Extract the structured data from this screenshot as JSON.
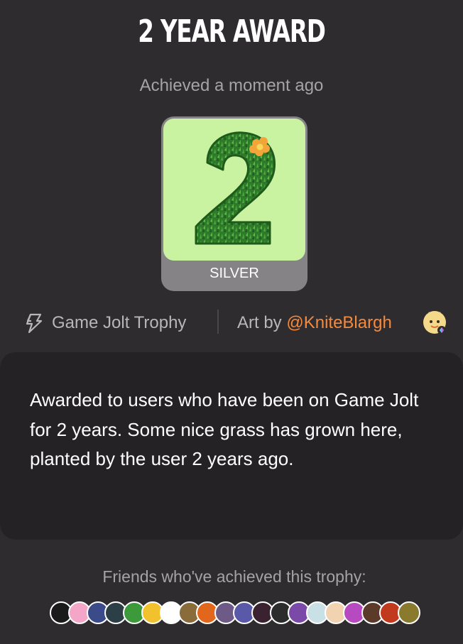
{
  "trophy": {
    "title": "2 YEAR AWARD",
    "achieved": "Achieved a moment ago",
    "tier": "SILVER",
    "art_icon": "grass-number-two-icon"
  },
  "meta": {
    "source_icon": "bolt-icon",
    "source": "Game Jolt Trophy",
    "art_by_prefix": "Art by ",
    "artist": "@KniteBlargh"
  },
  "description": "Awarded to users who have been on Game Jolt for 2 years. Some nice grass has grown here, planted by the user 2 years ago.",
  "friends": {
    "label": "Friends who've achieved this trophy:",
    "avatars": [
      {
        "name": "friend-avatar",
        "color": "#1a1a1a"
      },
      {
        "name": "friend-avatar",
        "color": "#f3a6c8"
      },
      {
        "name": "friend-avatar",
        "color": "#3b4b8a"
      },
      {
        "name": "friend-avatar",
        "color": "#2c3e46"
      },
      {
        "name": "friend-avatar",
        "color": "#3d9a3a"
      },
      {
        "name": "friend-avatar",
        "color": "#f2c12e"
      },
      {
        "name": "friend-avatar",
        "color": "#ffffff"
      },
      {
        "name": "friend-avatar",
        "color": "#8a6b3a"
      },
      {
        "name": "friend-avatar",
        "color": "#e2661c"
      },
      {
        "name": "friend-avatar",
        "color": "#6d5a86"
      },
      {
        "name": "friend-avatar",
        "color": "#5a58a8"
      },
      {
        "name": "friend-avatar",
        "color": "#3a2230"
      },
      {
        "name": "friend-avatar",
        "color": "#2c2c2c"
      },
      {
        "name": "friend-avatar",
        "color": "#7b4aa8"
      },
      {
        "name": "friend-avatar",
        "color": "#c8e0e6"
      },
      {
        "name": "friend-avatar",
        "color": "#f1d3b1"
      },
      {
        "name": "friend-avatar",
        "color": "#b74ac0"
      },
      {
        "name": "friend-avatar",
        "color": "#5b3a2a"
      },
      {
        "name": "friend-avatar",
        "color": "#c23a1e"
      },
      {
        "name": "friend-avatar",
        "color": "#8a7a2e"
      }
    ]
  },
  "colors": {
    "background": "#2f2c2f",
    "panel": "#242224",
    "accent": "#f48a3d",
    "muted_text": "#a6a2a6",
    "art_background": "#c9f2a1",
    "grass": "#2f7a2a"
  }
}
